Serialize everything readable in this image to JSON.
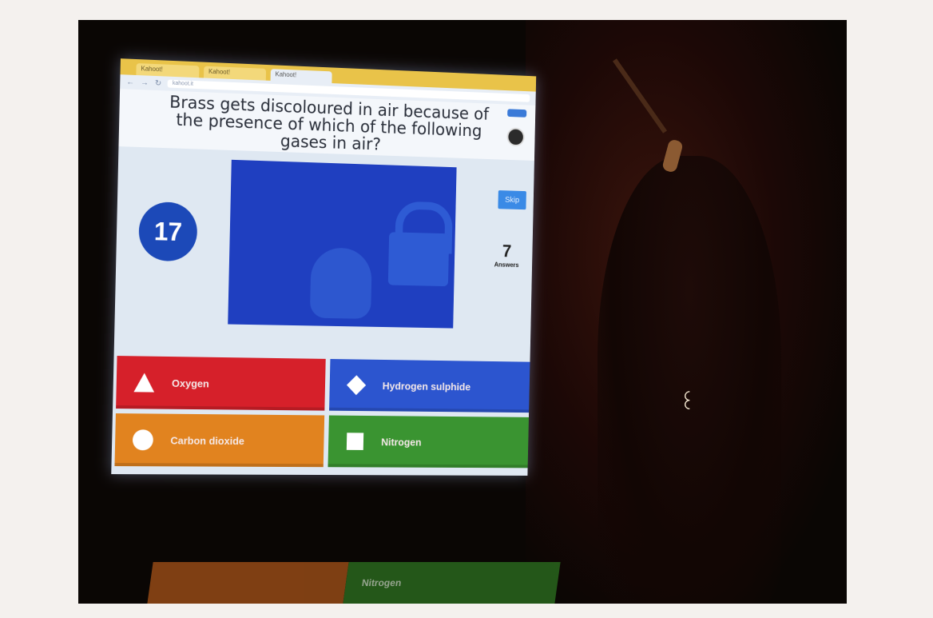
{
  "browser": {
    "tabs": [
      "Kahoot!",
      "Kahoot!",
      "Kahoot!"
    ],
    "url": "kahoot.it"
  },
  "quiz": {
    "question": "Brass gets discoloured in air because of the presence of which of the following gases in air?",
    "timer": "17",
    "skip_label": "Skip",
    "answers_count": "7",
    "answers_label": "Answers",
    "options": [
      {
        "label": "Oxygen",
        "color": "#d6202a",
        "shape": "triangle-icon"
      },
      {
        "label": "Hydrogen sulphide",
        "color": "#2c55cf",
        "shape": "diamond-icon"
      },
      {
        "label": "Carbon dioxide",
        "color": "#e1831f",
        "shape": "circle-icon"
      },
      {
        "label": "Nitrogen",
        "color": "#3a9431",
        "shape": "square-icon"
      }
    ]
  },
  "reflection": {
    "label": "Nitrogen"
  }
}
